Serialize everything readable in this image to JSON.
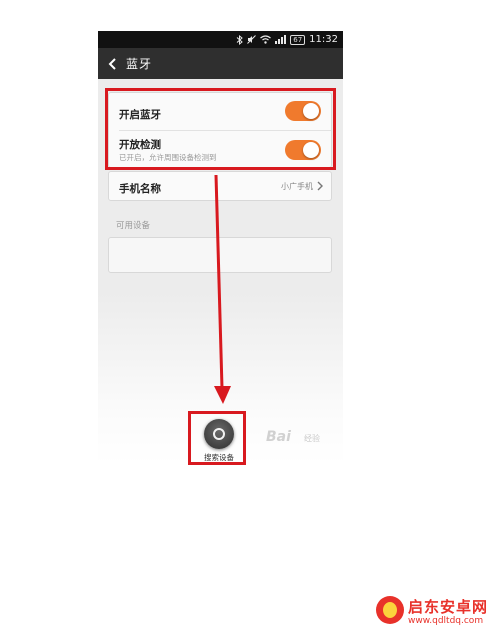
{
  "status_bar": {
    "battery": "67",
    "time": "11:32",
    "icons": [
      "bluetooth-icon",
      "mute-icon",
      "wifi-icon",
      "signal-icon"
    ]
  },
  "header": {
    "title": "蓝牙"
  },
  "settings": {
    "bluetooth_label": "开启蓝牙",
    "discover_label": "开放检测",
    "discover_desc": "已开启，允许周围设备检测到",
    "phone_name_label": "手机名称",
    "phone_name_value": "小广手机"
  },
  "available_devices": {
    "label": "可用设备"
  },
  "search": {
    "label": "搜索设备"
  },
  "watermark": {
    "text": "Bai",
    "sub": "经验"
  },
  "logo": {
    "name": "启东安卓网",
    "url": "www.qdltdq.com"
  },
  "colors": {
    "toggle_on": "#f07a2d",
    "highlight": "#d8191f",
    "header_bg": "#2f2f2f"
  }
}
